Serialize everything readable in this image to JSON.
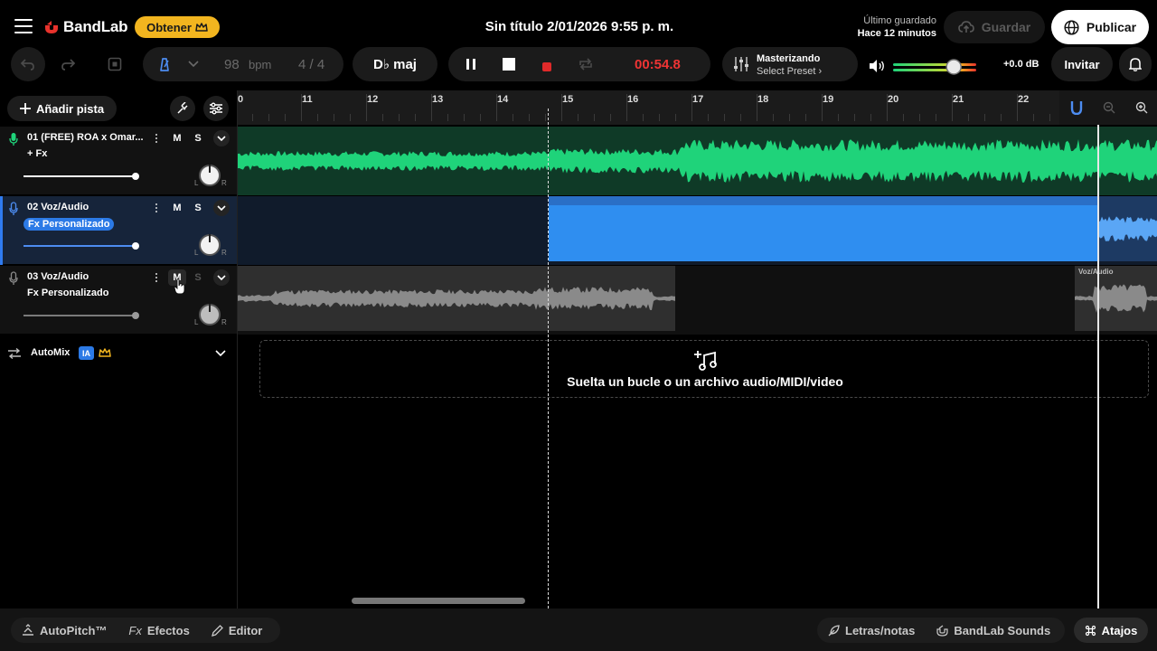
{
  "header": {
    "logo_text": "BandLab",
    "obtener_label": "Obtener",
    "document_title": "Sin título 2/01/2026 9:55 p. m.",
    "last_saved_label": "Último guardado",
    "last_saved_value": "Hace 12 minutos",
    "save_label": "Guardar",
    "publish_label": "Publicar"
  },
  "transport": {
    "bpm": "98",
    "bpm_unit": "bpm",
    "time_signature": "4 / 4",
    "key": "D♭ maj",
    "time": "00:54.8",
    "mastering_title": "Masterizando",
    "mastering_preset": "Select Preset ›",
    "master_gain": "+0.0 dB",
    "volume_level": 0.73,
    "invite_label": "Invitar"
  },
  "left_panel": {
    "add_track_label": "Añadir pista",
    "tracks": [
      {
        "name": "01  (FREE) ROA x Omar...",
        "fx": "+ Fx",
        "mute": "M",
        "solo": "S",
        "pan_l": "L",
        "pan_r": "R"
      },
      {
        "name": "02  Voz/Audio",
        "fx": "Fx Personalizado",
        "mute": "M",
        "solo": "S",
        "pan_l": "L",
        "pan_r": "R"
      },
      {
        "name": "03  Voz/Audio",
        "fx": "Fx Personalizado",
        "mute": "M",
        "solo": "S",
        "pan_l": "L",
        "pan_r": "R"
      }
    ],
    "automix_label": "AutoMix",
    "ia_badge": "IA"
  },
  "timeline": {
    "ruler_marks": [
      "0",
      "11",
      "12",
      "13",
      "14",
      "15",
      "16",
      "17",
      "18",
      "19",
      "20",
      "21",
      "22"
    ],
    "region_label": "Voz/Audio",
    "dropzone_text": "Suelta un bucle o un archivo audio/MIDI/video"
  },
  "bottom": {
    "autopitch": "AutoPitch™",
    "effects_prefix": "Fx",
    "effects": "Efectos",
    "editor": "Editor",
    "lyrics": "Letras/notas",
    "sounds": "BandLab Sounds",
    "shortcuts": "Atajos"
  },
  "colors": {
    "track1": "#1fd37a",
    "track2": "#2f8ef0",
    "track3": "#8a8a8a",
    "accent_gold": "#f2b51f",
    "time_red": "#ef3434"
  }
}
